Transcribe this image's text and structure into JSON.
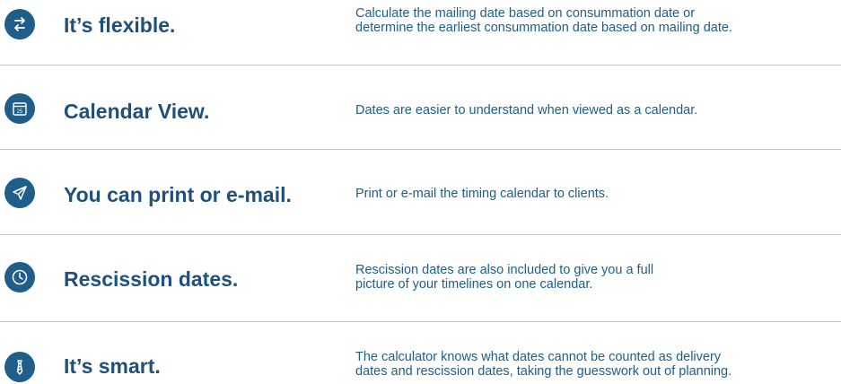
{
  "features": [
    {
      "icon": "swap-arrows-icon",
      "title": "It’s flexible.",
      "desc_line1": "Calculate the mailing date based on consummation date or",
      "desc_line2": "determine the earliest consummation date based on mailing date."
    },
    {
      "icon": "calendar-icon",
      "icon_text": "25",
      "title": "Calendar View.",
      "desc_line1": "Dates are easier to understand when viewed as a calendar."
    },
    {
      "icon": "paper-plane-icon",
      "title": "You can print or e-mail.",
      "desc_line1": "Print or e-mail the timing calendar to clients."
    },
    {
      "icon": "clock-icon",
      "title": "Rescission dates.",
      "desc_line1": "Rescission dates are also included to give you a full",
      "desc_line2": "picture of your timelines on one calendar."
    },
    {
      "icon": "tie-icon",
      "title": "It’s smart.",
      "desc_line1": "The calculator knows what dates cannot be counted as delivery",
      "desc_line2": "dates and rescission dates, taking the guesswork out of planning."
    }
  ],
  "colors": {
    "accent": "#1f5d8b",
    "title": "#1f4f7c",
    "divider": "#c9c9c9"
  }
}
